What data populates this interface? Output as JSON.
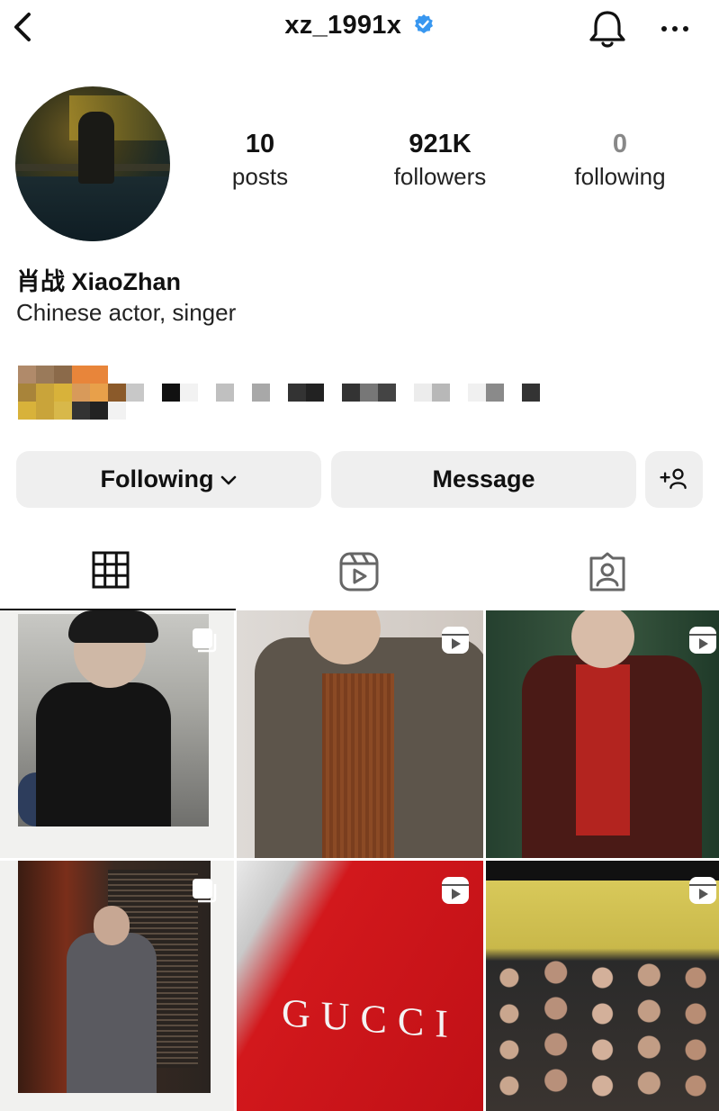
{
  "header": {
    "back_icon": "chevron-left-icon",
    "username": "xz_1991x",
    "verified_icon": "verified-badge-icon",
    "verified_color": "#3897f0",
    "bell_icon": "bell-icon",
    "more_icon": "more-horizontal-icon"
  },
  "profile": {
    "avatar_icon": "avatar",
    "stats": [
      {
        "value": "10",
        "label": "posts"
      },
      {
        "value": "921K",
        "label": "followers"
      },
      {
        "value": "0",
        "label": "following"
      }
    ],
    "display_name": "肖战 XiaoZhan",
    "bio": "Chinese actor, singer"
  },
  "actions": {
    "following_label": "Following",
    "following_icon": "chevron-down-icon",
    "message_label": "Message",
    "add_user_icon": "add-user-icon"
  },
  "tabs": [
    {
      "icon": "grid-icon",
      "active": true
    },
    {
      "icon": "reels-icon",
      "active": false
    },
    {
      "icon": "tagged-icon",
      "active": false
    }
  ],
  "posts": [
    {
      "type": "multi",
      "badge_icon": "multi-photo-icon"
    },
    {
      "type": "reel",
      "badge_icon": "reels-icon"
    },
    {
      "type": "reel",
      "badge_icon": "reels-icon"
    },
    {
      "type": "multi",
      "badge_icon": "multi-photo-icon"
    },
    {
      "type": "reel",
      "badge_icon": "reels-icon",
      "text": "GUCCI"
    },
    {
      "type": "reel",
      "badge_icon": "reels-icon"
    }
  ]
}
